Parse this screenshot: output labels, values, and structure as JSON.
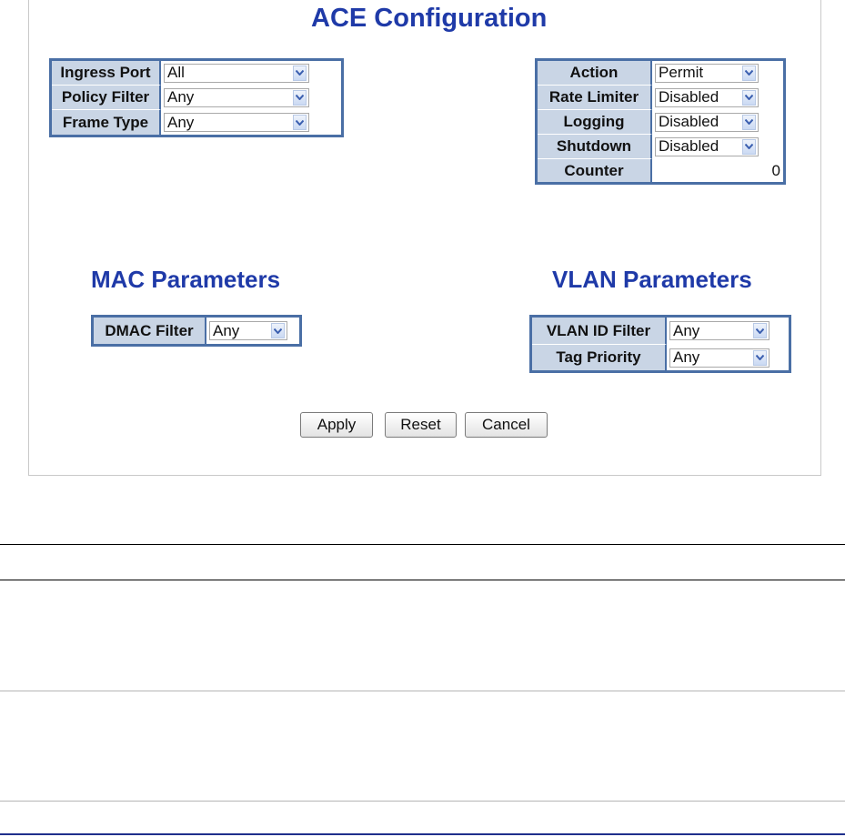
{
  "ace": {
    "title": "ACE Configuration",
    "ingress_port": {
      "label": "Ingress Port",
      "value": "All"
    },
    "policy_filter": {
      "label": "Policy Filter",
      "value": "Any"
    },
    "frame_type": {
      "label": "Frame Type",
      "value": "Any"
    },
    "action": {
      "label": "Action",
      "value": "Permit"
    },
    "rate_limiter": {
      "label": "Rate Limiter",
      "value": "Disabled"
    },
    "logging": {
      "label": "Logging",
      "value": "Disabled"
    },
    "shutdown": {
      "label": "Shutdown",
      "value": "Disabled"
    },
    "counter": {
      "label": "Counter",
      "value": "0"
    }
  },
  "mac": {
    "title": "MAC Parameters",
    "dmac_filter": {
      "label": "DMAC Filter",
      "value": "Any"
    }
  },
  "vlan": {
    "title": "VLAN Parameters",
    "vlan_id_filter": {
      "label": "VLAN ID Filter",
      "value": "Any"
    },
    "tag_priority": {
      "label": "Tag Priority",
      "value": "Any"
    }
  },
  "buttons": {
    "apply": "Apply",
    "reset": "Reset",
    "cancel": "Cancel"
  },
  "colors": {
    "title": "#1f3aa8",
    "label_bg": "#c9d5e5",
    "table_border": "#4a6fa5"
  }
}
